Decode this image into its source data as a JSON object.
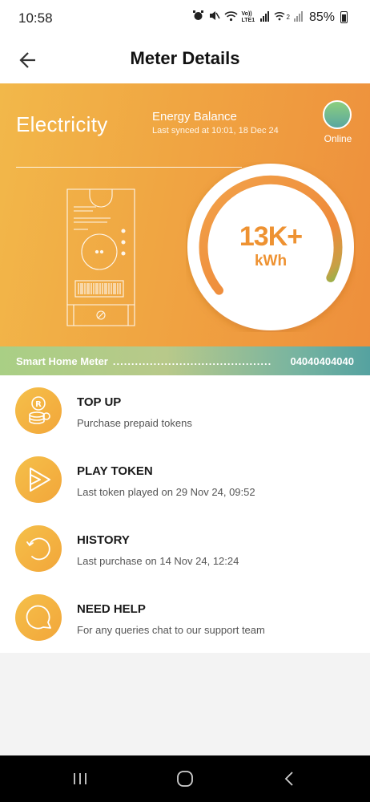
{
  "status_bar": {
    "time": "10:58",
    "network_label": "Vo)) LTE1",
    "sim2_label": "2",
    "battery": "85%"
  },
  "header": {
    "title": "Meter Details",
    "back_icon": "arrow-left-icon"
  },
  "meter_card": {
    "utility_type": "Electricity",
    "balance_label": "Energy Balance",
    "last_synced": "Last synced at 10:01, 18 Dec 24",
    "status": "Online",
    "balance_value": "13K+",
    "balance_unit": "kWh",
    "gauge_fill_fraction": 0.95,
    "meter_name": "Smart Home Meter",
    "meter_dots": "...........................................",
    "meter_number": "04040404040"
  },
  "actions": [
    {
      "title": "TOP UP",
      "subtitle": "Purchase prepaid tokens",
      "icon": "coins-icon"
    },
    {
      "title": "PLAY TOKEN",
      "subtitle": "Last token played on 29 Nov 24, 09:52",
      "icon": "play-icon"
    },
    {
      "title": "HISTORY",
      "subtitle": "Last purchase on 14 Nov 24, 12:24",
      "icon": "history-icon"
    },
    {
      "title": "NEED HELP",
      "subtitle": "For any queries chat to our support team",
      "icon": "chat-icon"
    }
  ],
  "colors": {
    "accent_orange": "#f0a542",
    "accent_green": "#55a2a0",
    "gauge_track": "#f0a04a",
    "gauge_good": "#6cc04a"
  },
  "nav": {
    "recent_icon": "recent-apps-icon",
    "home_icon": "home-icon",
    "back_icon": "back-chevron-icon"
  }
}
